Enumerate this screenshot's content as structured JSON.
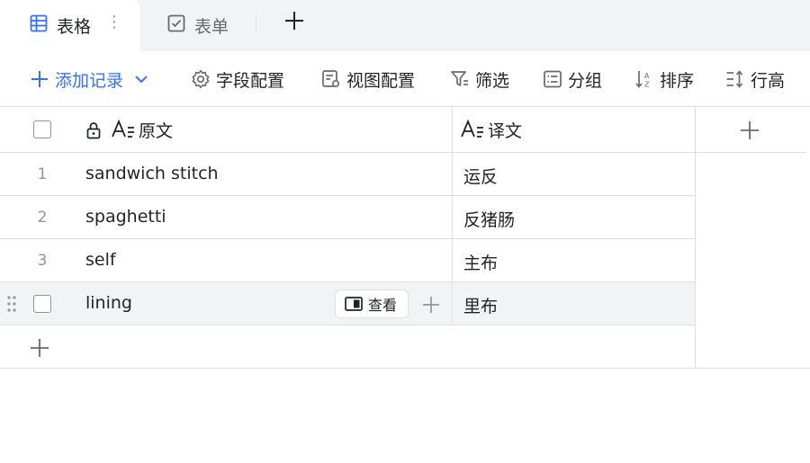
{
  "tabs": [
    {
      "label": "表格",
      "icon": "table-icon",
      "active": true
    },
    {
      "label": "表单",
      "icon": "form-icon",
      "active": false
    }
  ],
  "tab_more": "⋮",
  "toolbar": {
    "add_record": "添加记录",
    "field_config": "字段配置",
    "view_config": "视图配置",
    "filter": "筛选",
    "group": "分组",
    "sort": "排序",
    "row_height": "行高"
  },
  "columns": [
    {
      "label": "原文",
      "locked": true,
      "type_icon": "text-field-icon"
    },
    {
      "label": "译文",
      "locked": false,
      "type_icon": "text-field-icon"
    }
  ],
  "rows": [
    {
      "num": "1",
      "original": "sandwich stitch",
      "translation": "运反"
    },
    {
      "num": "2",
      "original": "spaghetti",
      "translation": "反猪肠"
    },
    {
      "num": "3",
      "original": "self",
      "translation": "主布"
    },
    {
      "num": "",
      "original": "lining",
      "translation": "里布",
      "hovered": true
    }
  ],
  "row_actions": {
    "view_label": "查看"
  },
  "colors": {
    "accent": "#3370ff",
    "border": "#dee0e3",
    "hover": "#f2f3f5",
    "muted": "#8f959e"
  }
}
